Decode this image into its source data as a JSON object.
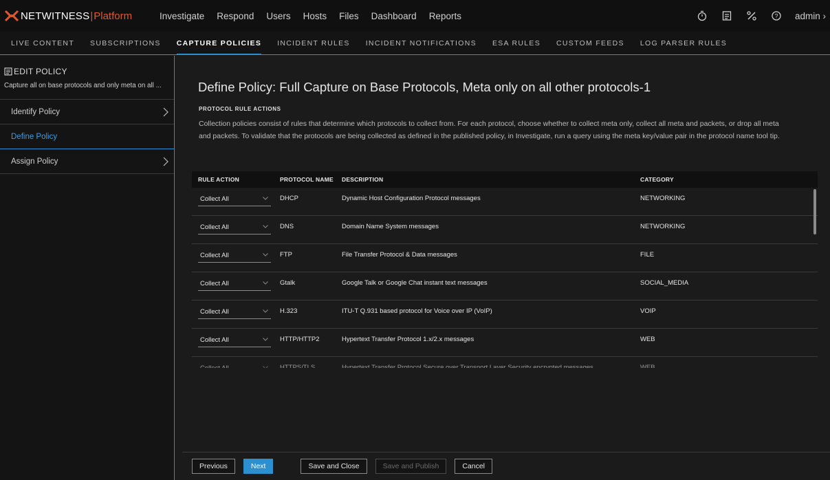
{
  "topbar": {
    "brand": "NETWITNESS",
    "separator": "|",
    "platform": "Platform",
    "nav": [
      "Investigate",
      "Respond",
      "Users",
      "Hosts",
      "Files",
      "Dashboard",
      "Reports"
    ],
    "user": "admin",
    "user_chevron": "›",
    "icons": [
      "timer-icon",
      "checklist-icon",
      "tools-icon",
      "help-icon"
    ]
  },
  "subnav": {
    "tabs": [
      "LIVE CONTENT",
      "SUBSCRIPTIONS",
      "CAPTURE POLICIES",
      "INCIDENT RULES",
      "INCIDENT NOTIFICATIONS",
      "ESA RULES",
      "CUSTOM FEEDS",
      "LOG PARSER RULES"
    ],
    "active": "CAPTURE POLICIES"
  },
  "sidebar": {
    "title": "EDIT POLICY",
    "subtitle": "Capture all on base protocols and only meta on all ...",
    "items": [
      {
        "label": "Identify Policy",
        "chevron": "›"
      },
      {
        "label": "Define Policy",
        "chevron": ""
      },
      {
        "label": "Assign Policy",
        "chevron": "›"
      }
    ],
    "active_index": 1
  },
  "main": {
    "title": "Define Policy: Full Capture on Base Protocols, Meta only on all other protocols-1",
    "section_title": "PROTOCOL RULE ACTIONS",
    "description": "Collection policies consist of rules that determine which protocols to collect from. For each protocol, choose whether to collect meta only, collect all meta and packets, or drop all meta and packets. To validate that the protocols are being collected as defined in the published policy, in Investigate, run a query using the meta key/value pair in the protocol name tool tip."
  },
  "table": {
    "headers": [
      "RULE ACTION",
      "PROTOCOL NAME",
      "DESCRIPTION",
      "CATEGORY"
    ],
    "rows": [
      {
        "action": "Collect All",
        "protocol": "DHCP",
        "description": "Dynamic Host Configuration Protocol messages",
        "category": "NETWORKING"
      },
      {
        "action": "Collect All",
        "protocol": "DNS",
        "description": "Domain Name System messages",
        "category": "NETWORKING"
      },
      {
        "action": "Collect All",
        "protocol": "FTP",
        "description": "File Transfer Protocol & Data messages",
        "category": "FILE"
      },
      {
        "action": "Collect All",
        "protocol": "Gtalk",
        "description": "Google Talk or Google Chat instant text messages",
        "category": "SOCIAL_MEDIA"
      },
      {
        "action": "Collect All",
        "protocol": "H.323",
        "description": "ITU-T Q.931 based protocol for Voice over IP (VoIP)",
        "category": "VOIP"
      },
      {
        "action": "Collect All",
        "protocol": "HTTP/HTTP2",
        "description": "Hypertext Transfer Protocol 1.x/2.x messages",
        "category": "WEB"
      },
      {
        "action": "Collect All",
        "protocol": "HTTPS/TLS",
        "description": "Hypertext Transfer Protocol Secure over Transport Layer Security encrypted messages",
        "category": "WEB"
      }
    ]
  },
  "footer": {
    "previous": "Previous",
    "next": "Next",
    "save_close": "Save and Close",
    "save_publish": "Save and Publish",
    "cancel": "Cancel"
  },
  "colors": {
    "accent": "#2c8fd0",
    "brand_orange": "#e0582b",
    "background": "#1b1b1b"
  }
}
